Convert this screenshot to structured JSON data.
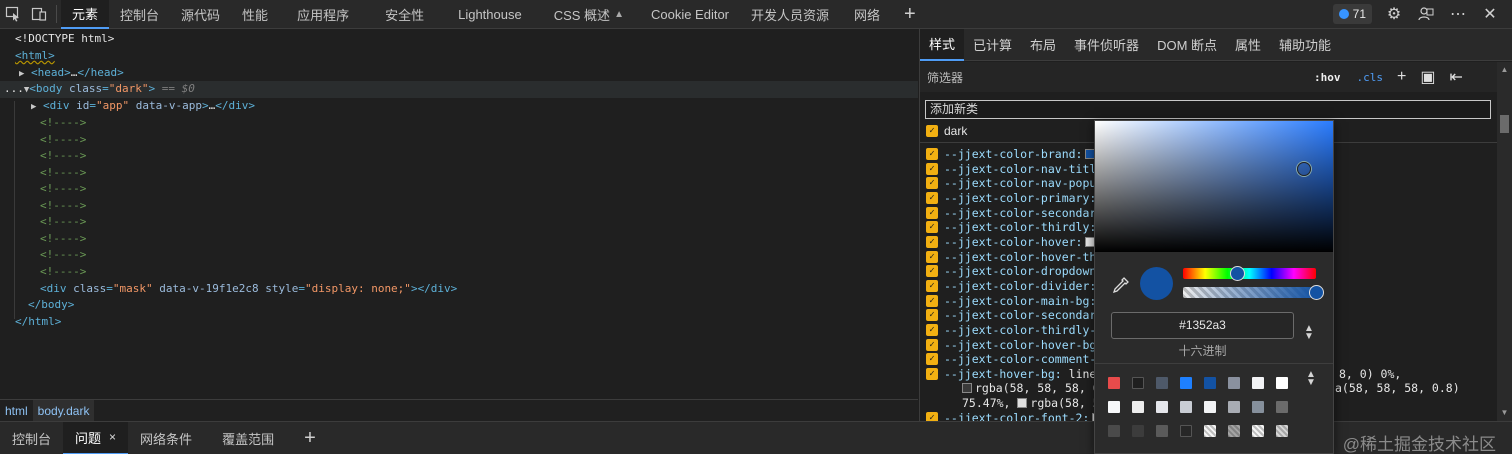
{
  "toolbar": {
    "tabs": [
      {
        "label": "元素"
      },
      {
        "label": "控制台"
      },
      {
        "label": "源代码"
      },
      {
        "label": "性能"
      },
      {
        "label": "应用程序"
      },
      {
        "label": "安全性"
      },
      {
        "label": "Lighthouse"
      },
      {
        "label": "CSS 概述"
      },
      {
        "label": "Cookie Editor"
      },
      {
        "label": "开发人员资源"
      },
      {
        "label": "网络"
      }
    ],
    "issues_count": "71",
    "icons": [
      "inspect-icon",
      "device-icon",
      "add-tab-icon",
      "settings-icon",
      "feedback-icon",
      "more-icon",
      "close-icon"
    ]
  },
  "elements": {
    "doctype": "<!DOCTYPE html>",
    "html_open": "<html>",
    "head": {
      "open": "<head>",
      "ellipsis": "…",
      "close": "</head>"
    },
    "body": {
      "prefix": "...",
      "open": "<body",
      "attr": "class",
      "val": "\"dark\"",
      "gt": ">",
      "eq": "== $0"
    },
    "div_app": {
      "open": "<div",
      "attr1": "id",
      "val1": "\"app\"",
      "attr2": "data-v-app",
      "gt": ">",
      "ellipsis": "…",
      "close": "</div>"
    },
    "comments": [
      "<!---->",
      "<!---->",
      "<!---->",
      "<!---->",
      "<!---->",
      "<!---->",
      "<!---->",
      "<!---->",
      "<!---->",
      "<!---->"
    ],
    "div_mask": {
      "open": "<div",
      "attr1": "class",
      "val1": "\"mask\"",
      "attr2": "data-v-19f1e2c8",
      "attr3": "style",
      "val3": "\"display: none;\"",
      "gt": ">",
      "close": "</div>"
    },
    "body_close": "</body>",
    "html_close": "</html>"
  },
  "breadcrumbs": [
    {
      "label": "html"
    },
    {
      "label": "body.dark"
    }
  ],
  "drawer": {
    "tabs": [
      {
        "label": "控制台"
      },
      {
        "label": "问题"
      },
      {
        "label": "网络条件"
      },
      {
        "label": "覆盖范围"
      }
    ],
    "close": "×",
    "watermark": "@稀土掘金技术社区"
  },
  "styles_panel": {
    "tabs": [
      {
        "label": "样式"
      },
      {
        "label": "已计算"
      },
      {
        "label": "布局"
      },
      {
        "label": "事件侦听器"
      },
      {
        "label": "DOM 断点"
      },
      {
        "label": "属性"
      },
      {
        "label": "辅助功能"
      }
    ],
    "filter_placeholder": "筛选器",
    "hov": ":hov",
    "cls": ".cls",
    "add_class_placeholder": "添加新类",
    "class_toggle": "dark",
    "properties": [
      {
        "name": "--jjext-color-brand:",
        "swatch": "#1352a3"
      },
      {
        "name": "--jjext-color-nav-title"
      },
      {
        "name": "--jjext-color-nav-popup"
      },
      {
        "name": "--jjext-color-primary:"
      },
      {
        "name": "--jjext-color-secondary"
      },
      {
        "name": "--jjext-color-thirdly:"
      },
      {
        "name": "--jjext-color-hover:",
        "swatch": "#e8e8e8"
      },
      {
        "name": "--jjext-color-hover-thi"
      },
      {
        "name": "--jjext-color-dropdown-"
      },
      {
        "name": "--jjext-color-divider:"
      },
      {
        "name": "--jjext-color-main-bg:"
      },
      {
        "name": "--jjext-color-secondary"
      },
      {
        "name": "--jjext-color-thirdly-b"
      },
      {
        "name": "--jjext-color-hover-bg:"
      },
      {
        "name": "--jjext-color-comment-b"
      }
    ],
    "hover_bg": {
      "name": "--jjext-hover-bg:",
      "line1_start": "linea",
      "line1_end": "8, 0) 0%,",
      "line2_start": "rgba(58, 58, 58, 0",
      "line2_end": "a(58, 58, 58, 0.8)",
      "line3_start": "75.47%,",
      "line3_mid": "rgba(58, 5"
    },
    "font2": {
      "name": "--jjext-color-font-2:"
    }
  },
  "color_picker": {
    "color": "#1352a3",
    "hex_value": "#1352a3",
    "format_label": "十六进制",
    "palette": [
      [
        "#e84b4b",
        "#1f1f1f",
        "#4e5969",
        "#1e80ff",
        "#1352a3",
        "#8a919f",
        "#f2f3f5",
        "#ffffff"
      ],
      [
        "#f7f8fa",
        "#ededed",
        "#e5e6eb",
        "#c9cdd4",
        "#f2f3f5",
        "#a8acb3",
        "#86909c",
        "#6b6b6b"
      ],
      [
        "#4a4a4a",
        "#3c3c3c",
        "#5a5a5a",
        "#272727",
        "checker",
        "checker-dark",
        "checker",
        "checker-light"
      ]
    ]
  }
}
